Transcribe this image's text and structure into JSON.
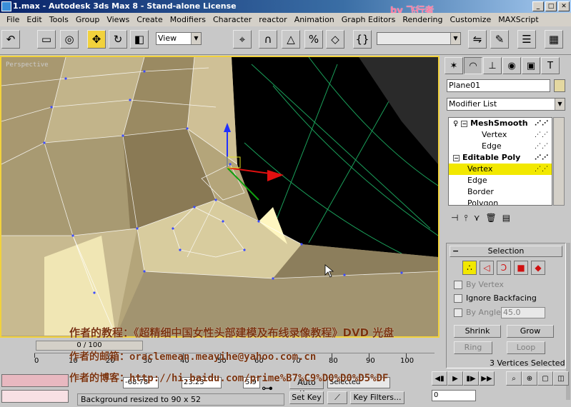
{
  "window": {
    "title": "1.max - Autodesk 3ds Max 8 - Stand-alone License"
  },
  "menu": [
    "File",
    "Edit",
    "Tools",
    "Group",
    "Views",
    "Create",
    "Modifiers",
    "Character",
    "reactor",
    "Animation",
    "Graph Editors",
    "Rendering",
    "Customize",
    "MAXScript"
  ],
  "toolbar": {
    "view_value": "View"
  },
  "viewport": {
    "label": "Perspective"
  },
  "cmd": {
    "object_name": "Plane01",
    "modifier_list": "Modifier List",
    "stack": [
      {
        "label": "MeshSmooth",
        "bold": true,
        "expander": "⊟"
      },
      {
        "label": "Vertex",
        "bold": false,
        "indent": 1
      },
      {
        "label": "Edge",
        "bold": false,
        "indent": 1
      },
      {
        "label": "Editable Poly",
        "bold": true,
        "expander": "⊟"
      },
      {
        "label": "Vertex",
        "bold": false,
        "indent": 1,
        "highlight": true
      },
      {
        "label": "Edge",
        "bold": false,
        "indent": 1
      },
      {
        "label": "Border",
        "bold": false,
        "indent": 1
      },
      {
        "label": "Polygon",
        "bold": false,
        "indent": 1
      }
    ],
    "selection": {
      "title": "Selection",
      "by_vertex": "By Vertex",
      "ignore_backfacing": "Ignore Backfacing",
      "by_angle": "By Angle:",
      "angle_value": "45.0",
      "shrink": "Shrink",
      "grow": "Grow",
      "ring": "Ring",
      "loop": "Loop",
      "status": "3 Vertices Selected"
    }
  },
  "time": {
    "slider": "0 / 100",
    "ticks": [
      "0",
      "10",
      "20",
      "30",
      "40",
      "50",
      "60",
      "70",
      "80",
      "90",
      "100"
    ]
  },
  "status": {
    "x_value": "-68.78",
    "y_value": "23.23",
    "z_value": "5.9",
    "prompt": "Background resized to 90 x 52",
    "auto_key": "Auto Key",
    "set_key": "Set Key",
    "selected": "Selected",
    "key_filters": "Key Filters...",
    "frame": "0"
  },
  "overlay": {
    "line1": "作者的教程：《超精细中国女性头部建模及布线录像教程》DVD 光盘",
    "line2": "作者的邮箱：oraclemean.meayihe@yahoo.com.cn",
    "line3": "作者的博客：http://hi.baidu.com/prime%B7%C9%D0%D0%D5%DF",
    "corner": "by 飞行者"
  }
}
